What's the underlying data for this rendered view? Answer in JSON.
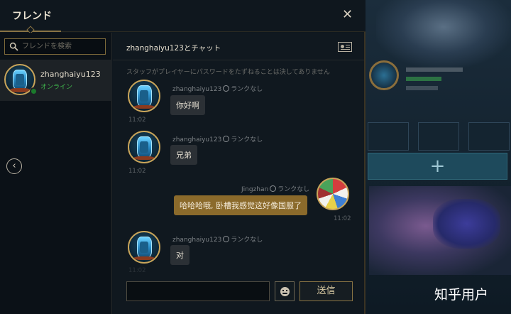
{
  "header": {
    "title": "フレンド",
    "close_glyph": "✕"
  },
  "sidebar": {
    "search_placeholder": "フレンドを検索",
    "friend": {
      "name": "zhanghaiyu123",
      "status": "オンライン"
    },
    "back_glyph": "‹"
  },
  "chat": {
    "title": "zhanghaiyu123とチャット",
    "notice": "スタッフがプレイヤーにパスワードをたずねることは決してありません",
    "messages": [
      {
        "sender": "zhanghaiyu123",
        "rank": "ランクなし",
        "text": "你好啊",
        "time": "11:02"
      },
      {
        "sender": "zhanghaiyu123",
        "rank": "ランクなし",
        "text": "兄弟",
        "time": "11:02"
      },
      {
        "sender": "Jingzhan",
        "rank": "ランクなし",
        "text": "哈哈哈哦, 卧槽我感觉这好像国服了",
        "time": "11:02"
      },
      {
        "sender": "zhanghaiyu123",
        "rank": "ランクなし",
        "text": "对",
        "time": "11:02"
      }
    ],
    "input_value": "",
    "send_label": "送信"
  },
  "background": {
    "plus_glyph": "+"
  },
  "watermark": "知乎用户",
  "colors": {
    "accent_gold": "#c9a55a",
    "online_green": "#3fb54c",
    "my_bubble": "#8b6a2b",
    "their_bubble": "#2b3035"
  },
  "icons": [
    "search-icon",
    "close-icon",
    "back-arrow-icon",
    "profile-card-icon",
    "rank-icon",
    "emoji-icon"
  ]
}
